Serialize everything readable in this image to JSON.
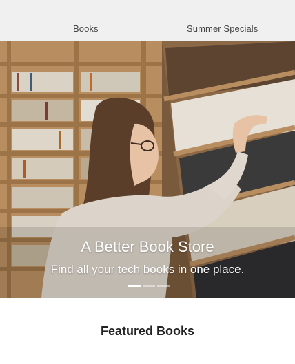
{
  "nav": {
    "items": [
      {
        "label": "Books"
      },
      {
        "label": "Summer Specials"
      }
    ]
  },
  "hero": {
    "title": "A Better Book Store",
    "subtitle": "Find all your tech books in one place.",
    "slides": 3,
    "active_slide": 1
  },
  "featured": {
    "heading": "Featured Books"
  },
  "colors": {
    "nav_bg": "#f0f0f0",
    "hero_text": "#ffffff",
    "page_bg": "#ffffff"
  }
}
